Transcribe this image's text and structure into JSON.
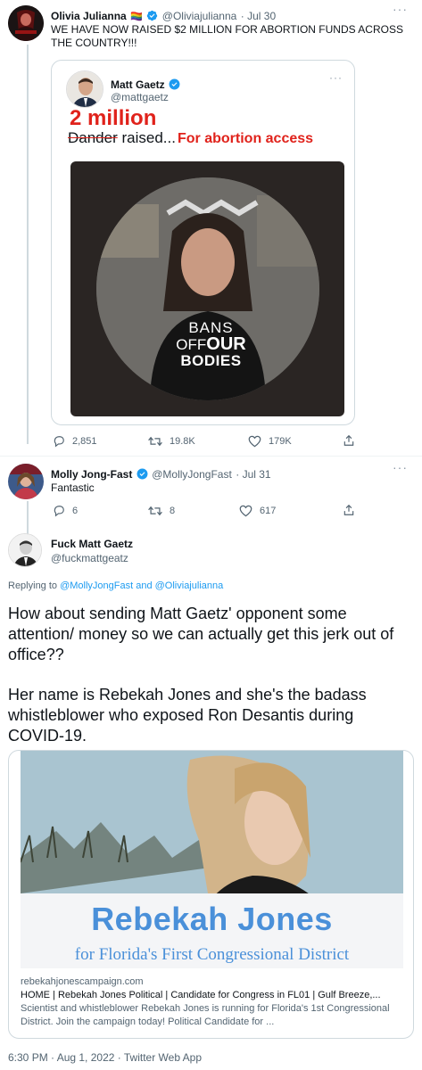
{
  "tweet1": {
    "name": "Olivia Julianna",
    "emoji": "🏳‍🌈",
    "handle": "@Oliviajulianna",
    "date": "· Jul 30",
    "text": "WE HAVE NOW RAISED $2 MILLION FOR ABORTION FUNDS ACROSS THE COUNTRY!!!",
    "quote": {
      "name": "Matt Gaetz",
      "handle": "@mattgaetz",
      "overlay_amount": "2 million",
      "crossed_word": "Dander",
      "raised_text": " raised...",
      "overlay_cause": "For abortion access",
      "shirt_line1": "BANS",
      "shirt_line2a": "OFF",
      "shirt_line2b": "OUR",
      "shirt_line3": "BODIES"
    },
    "actions": {
      "replies": "2,851",
      "retweets": "19.8K",
      "likes": "179K"
    }
  },
  "tweet2": {
    "name": "Molly Jong-Fast",
    "handle": "@MollyJongFast",
    "date": "· Jul 31",
    "text": "Fantastic",
    "actions": {
      "replies": "6",
      "retweets": "8",
      "likes": "617"
    }
  },
  "tweet3": {
    "name": "Fuck Matt Gaetz",
    "handle": "@fuckmattgeatz",
    "reply_prefix": "Replying to ",
    "reply_users": "@MollyJongFast and @Oliviajulianna",
    "para1": "How about sending Matt Gaetz' opponent some attention/ money so we can actually get this jerk out of office??",
    "para2": "Her name is Rebekah Jones and she's the badass whistleblower who exposed Ron Desantis during COVID-19.",
    "card": {
      "banner_title": "Rebekah Jones",
      "banner_sub": "for Florida's First Congressional District",
      "domain": "rebekahjonescampaign.com",
      "title": "HOME | Rebekah Jones Political | Candidate for Congress in FL01 | Gulf Breeze,...",
      "desc": "Scientist and whistleblower Rebekah Jones is running for Florida's 1st Congressional District. Join the campaign today! Political Candidate for ..."
    },
    "timestamp": "6:30 PM · Aug 1, 2022 · Twitter Web App"
  },
  "colors": {
    "verified": "#1d9bf0",
    "overlay_red": "#e0221b",
    "banner_blue": "#4a90d9",
    "muted": "#536471"
  },
  "icons": [
    "verified-badge-icon",
    "reply-icon",
    "retweet-icon",
    "like-icon",
    "share-icon",
    "more-icon"
  ]
}
